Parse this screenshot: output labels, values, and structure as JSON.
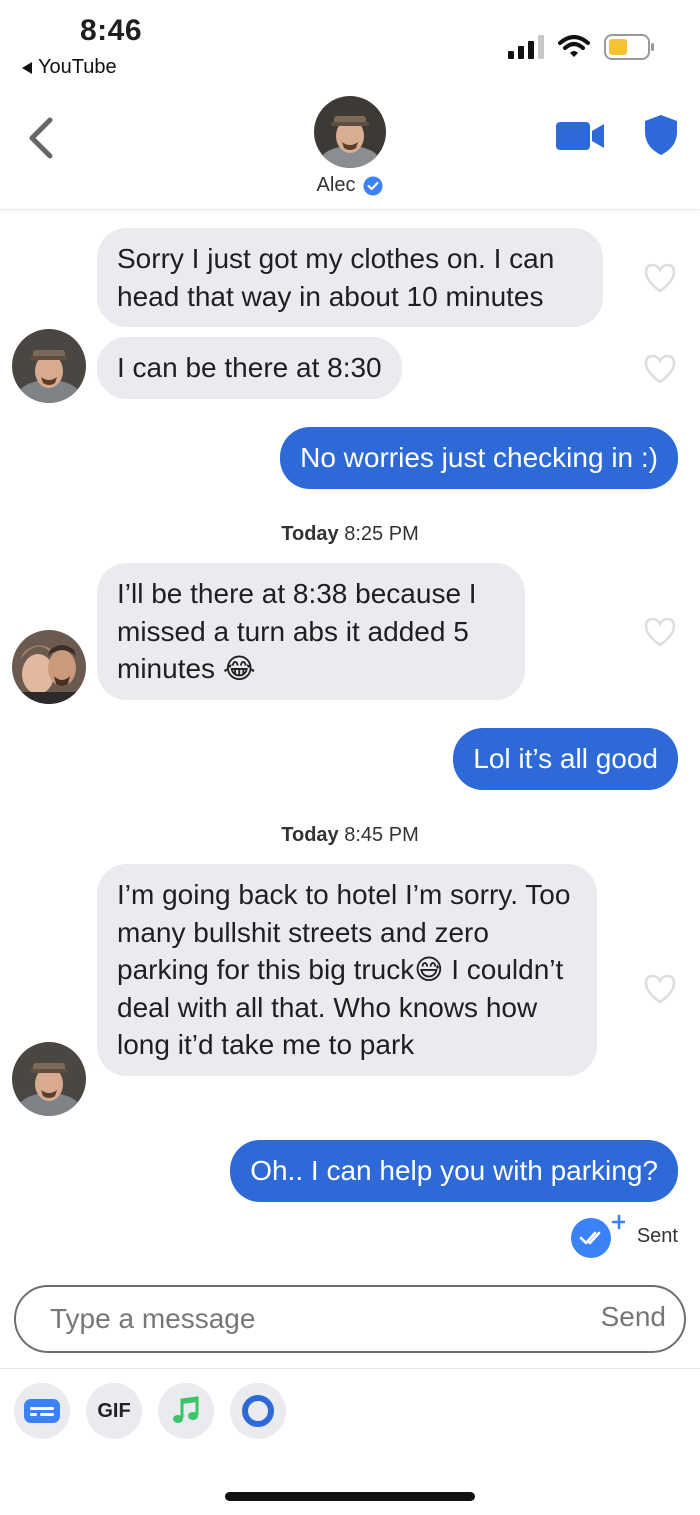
{
  "status_bar": {
    "time": "8:46",
    "back_app": "YouTube"
  },
  "header": {
    "name": "Alec"
  },
  "messages": [
    {
      "dir": "in",
      "text": "Sorry I just got my clothes on. I can head that way in about 10 minutes"
    },
    {
      "dir": "in",
      "text": "I can be there at 8:30"
    },
    {
      "dir": "out",
      "text": "No worries just checking in :)"
    },
    {
      "dir": "in",
      "text": "I’ll be there at 8:38 because I missed a turn abs it added 5 minutes 😂"
    },
    {
      "dir": "out",
      "text": "Lol it’s all good"
    },
    {
      "dir": "in",
      "text": "I’m going back to hotel I’m sorry. Too many bullshit streets and zero parking for this big truck😅 I couldn’t deal with all that. Who knows how long it’d take me to park"
    },
    {
      "dir": "out",
      "text": "Oh.. I can help you with parking?"
    }
  ],
  "timestamps": [
    {
      "day": "Today",
      "time": "8:25 PM"
    },
    {
      "day": "Today",
      "time": "8:45 PM"
    }
  ],
  "sent_status": "Sent",
  "composer": {
    "placeholder": "Type a message",
    "send_label": "Send"
  },
  "tools": {
    "gif_label": "GIF"
  },
  "colors": {
    "accent": "#2d6ad8",
    "incoming_bubble": "#eaebef",
    "verified": "#3b82f6"
  }
}
